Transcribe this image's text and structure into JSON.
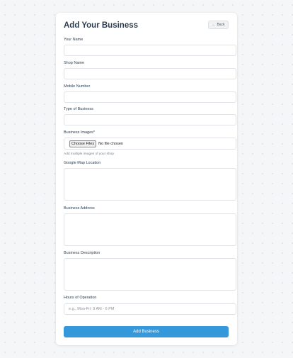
{
  "header": {
    "title": "Add Your Business",
    "back_label": "Back",
    "back_icon": "arrow-left-icon"
  },
  "form": {
    "your_name": {
      "label": "Your Name",
      "value": "",
      "placeholder": ""
    },
    "shop_name": {
      "label": "Shop Name",
      "value": "",
      "placeholder": ""
    },
    "mobile_number": {
      "label": "Mobile Number",
      "value": "",
      "placeholder": ""
    },
    "type_of_business": {
      "label": "Type of Business",
      "value": "",
      "placeholder": ""
    },
    "business_images": {
      "label": "Business Images*",
      "button_label": "Choose Files",
      "status": "No file chosen",
      "hint": "Add multiple images of your shop"
    },
    "google_map_location": {
      "label": "Google Map Location",
      "value": "",
      "placeholder": ""
    },
    "business_address": {
      "label": "Business Address",
      "value": "",
      "placeholder": ""
    },
    "business_description": {
      "label": "Business Description",
      "value": "",
      "placeholder": ""
    },
    "hours_of_operation": {
      "label": "Hours of Operation",
      "value": "",
      "placeholder": "e.g., Mon-Fri: 9 AM - 6 PM"
    },
    "submit_label": "Add Business"
  },
  "colors": {
    "accent": "#3498db",
    "text": "#2c3e50",
    "background": "#f5f6f8"
  }
}
